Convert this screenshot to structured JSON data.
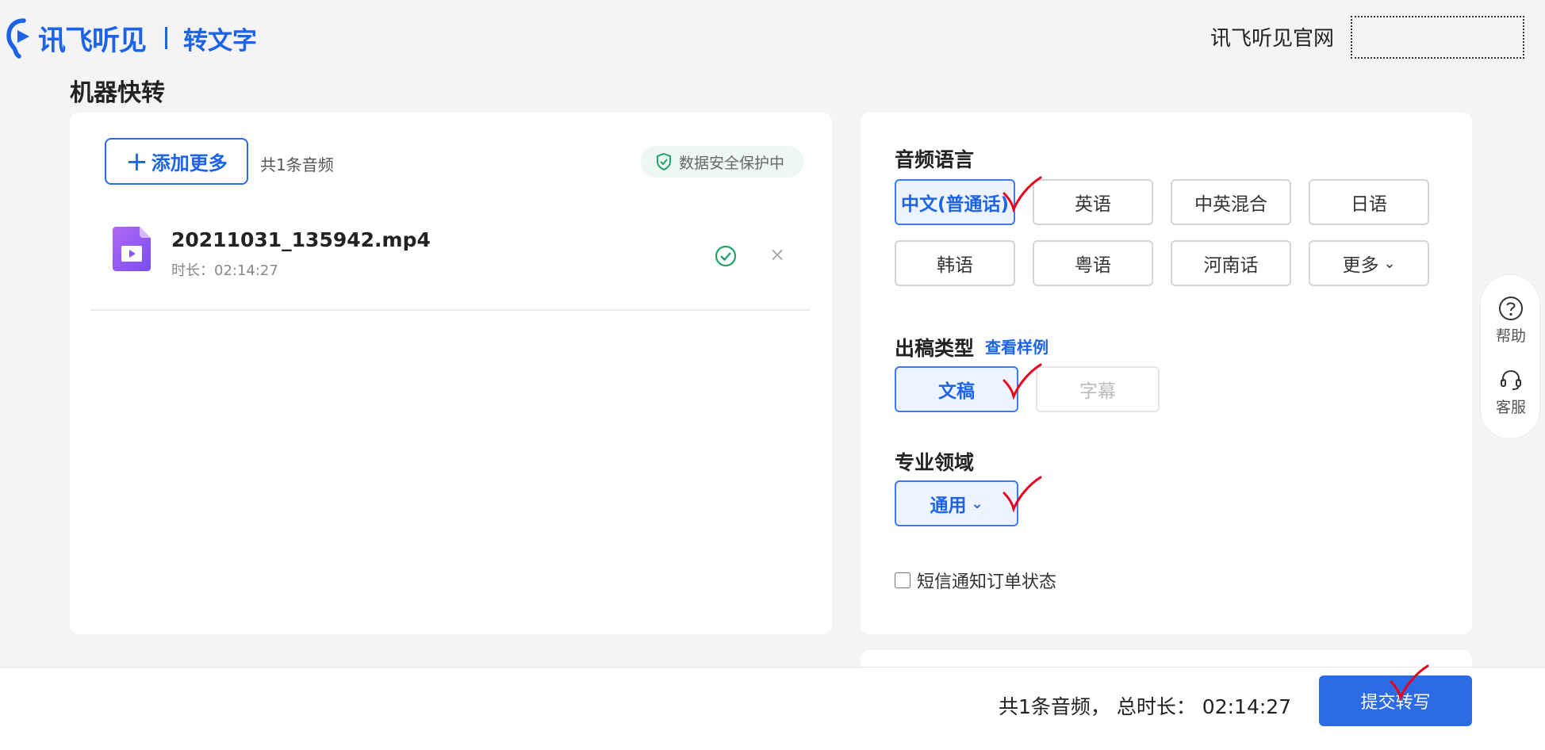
{
  "header": {
    "brand": "讯飞听见",
    "product": "转文字",
    "site_link": "讯飞听见官网"
  },
  "page_title": "机器快转",
  "upload": {
    "add_more": "添加更多",
    "count": "共1条音频",
    "safety_badge": "数据安全保护中"
  },
  "files": [
    {
      "name": "20211031_135942.mp4",
      "duration": "时长：02:14:27",
      "status": "success"
    }
  ],
  "settings": {
    "language_label": "音频语言",
    "languages": [
      "中文(普通话)",
      "英语",
      "中英混合",
      "日语",
      "韩语",
      "粤语",
      "河南话",
      "更多"
    ],
    "selected_language": "中文(普通话)",
    "output_label": "出稿类型",
    "sample_link": "查看样例",
    "output_types": [
      "文稿",
      "字幕"
    ],
    "selected_output": "文稿",
    "domain_label": "专业领域",
    "domain_value": "通用",
    "sms_label": "短信通知订单状态",
    "sms_checked": false
  },
  "side_tools": [
    "帮助",
    "客服"
  ],
  "footer": {
    "summary": "共1条音频， 总时长： 02:14:27",
    "submit": "提交转写"
  },
  "colors": {
    "accent": "#2b6ce6",
    "selected_bg": "#eef4ff",
    "success": "#21a366",
    "annotation": "#e8001c"
  }
}
